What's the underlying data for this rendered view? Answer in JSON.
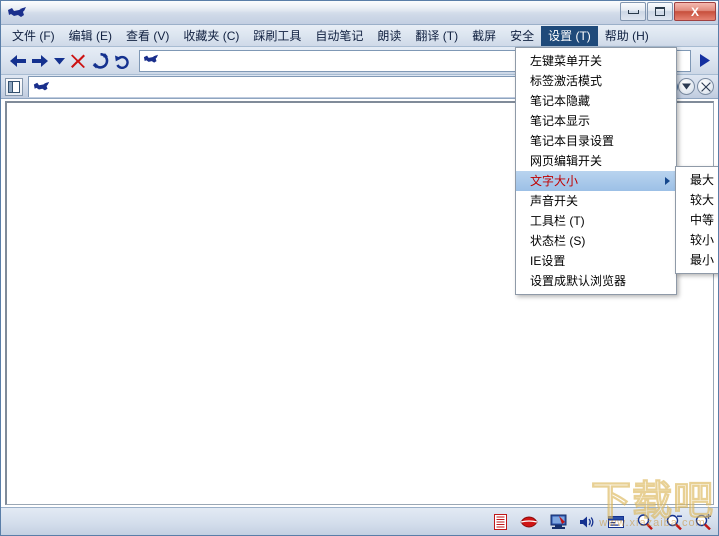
{
  "window": {
    "title": "",
    "icon": "dog-icon",
    "minimize_label": "",
    "maximize_label": "",
    "close_label": "X"
  },
  "menubar": {
    "items": [
      {
        "label": "文件 (F)",
        "active": false,
        "name": "menu-file"
      },
      {
        "label": "编辑 (E)",
        "active": false,
        "name": "menu-edit"
      },
      {
        "label": "查看 (V)",
        "active": false,
        "name": "menu-view"
      },
      {
        "label": "收藏夹 (C)",
        "active": false,
        "name": "menu-favorites"
      },
      {
        "label": "踩刷工具",
        "active": false,
        "name": "menu-crawl-tools"
      },
      {
        "label": "自动笔记",
        "active": false,
        "name": "menu-auto-notes"
      },
      {
        "label": "朗读",
        "active": false,
        "name": "menu-read-aloud"
      },
      {
        "label": "翻译 (T)",
        "active": false,
        "name": "menu-translate"
      },
      {
        "label": "截屏",
        "active": false,
        "name": "menu-screenshot"
      },
      {
        "label": "安全",
        "active": false,
        "name": "menu-security"
      },
      {
        "label": "设置 (T)",
        "active": true,
        "name": "menu-settings"
      },
      {
        "label": "帮助 (H)",
        "active": false,
        "name": "menu-help"
      }
    ]
  },
  "toolbar": {
    "back_icon": "back-arrow-icon",
    "forward_icon": "forward-arrow-icon",
    "history_dropdown_icon": "chevron-down-icon",
    "stop_icon": "stop-x-icon",
    "refresh_icon": "refresh-icon",
    "undo_icon": "undo-icon",
    "address_value": "",
    "address_placeholder": "",
    "go_icon": "go-arrow-icon"
  },
  "tabbar": {
    "sidebar_toggle_icon": "sidebar-panel-icon",
    "tab_title": "",
    "tab_icon": "dog-icon",
    "close_label": "×",
    "new_tab_label": "+",
    "list_icon": "chevron-down-icon",
    "close_all_label": "×"
  },
  "dropdown": {
    "items": [
      {
        "label": "左键菜单开关",
        "name": "settings-left-click-menu-toggle",
        "highlighted": false,
        "submenu": false
      },
      {
        "label": "标签激活模式",
        "name": "settings-tab-activation-mode",
        "highlighted": false,
        "submenu": false
      },
      {
        "label": "笔记本隐藏",
        "name": "settings-notebook-hide",
        "highlighted": false,
        "submenu": false
      },
      {
        "label": "笔记本显示",
        "name": "settings-notebook-show",
        "highlighted": false,
        "submenu": false
      },
      {
        "label": "笔记本目录设置",
        "name": "settings-notebook-directory",
        "highlighted": false,
        "submenu": false
      },
      {
        "label": "网页编辑开关",
        "name": "settings-webpage-edit-toggle",
        "highlighted": false,
        "submenu": false
      },
      {
        "label": "文字大小",
        "name": "settings-text-size",
        "highlighted": true,
        "submenu": true
      },
      {
        "label": "声音开关",
        "name": "settings-sound-toggle",
        "highlighted": false,
        "submenu": false
      },
      {
        "label": "工具栏 (T)",
        "name": "settings-toolbar",
        "highlighted": false,
        "submenu": false
      },
      {
        "label": "状态栏 (S)",
        "name": "settings-statusbar",
        "highlighted": false,
        "submenu": false
      },
      {
        "label": "IE设置",
        "name": "settings-ie-settings",
        "highlighted": false,
        "submenu": false
      },
      {
        "label": "设置成默认浏览器",
        "name": "settings-set-default-browser",
        "highlighted": false,
        "submenu": false
      }
    ]
  },
  "submenu": {
    "items": [
      {
        "label": "最大",
        "name": "text-size-largest"
      },
      {
        "label": "较大",
        "name": "text-size-larger"
      },
      {
        "label": "中等",
        "name": "text-size-medium"
      },
      {
        "label": "较小",
        "name": "text-size-smaller"
      },
      {
        "label": "最小",
        "name": "text-size-smallest"
      }
    ]
  },
  "statusbar": {
    "icons": [
      {
        "name": "document-list-icon"
      },
      {
        "name": "red-lips-icon"
      },
      {
        "name": "monitor-icon"
      },
      {
        "name": "speaker-icon"
      },
      {
        "name": "window-icon"
      },
      {
        "name": "magnifier-icon"
      },
      {
        "name": "zoom-out-icon"
      },
      {
        "name": "zoom-in-icon"
      }
    ]
  },
  "watermark": {
    "main": "下载吧",
    "sub": "www.xiazaiba.com"
  },
  "colors": {
    "accent": "#1f4a7a",
    "highlight": "#9cc0e6",
    "highlight_text": "#c00000",
    "icon_blue": "#123a8c",
    "icon_red": "#cc1111"
  }
}
